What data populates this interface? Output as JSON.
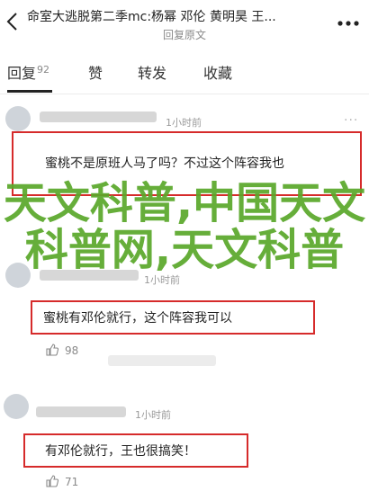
{
  "header": {
    "title": "命室大逃脱第二季mc:杨幂 邓伦 黄明昊 王...",
    "subtitle": "回复原文"
  },
  "tabs": [
    {
      "label": "回复",
      "count": "92"
    },
    {
      "label": "赞"
    },
    {
      "label": "转发"
    },
    {
      "label": "收藏"
    }
  ],
  "comments": [
    {
      "time": "1小时前",
      "text": "蜜桃不是原班人马了吗？不过这个阵容我也"
    },
    {
      "time": "1小时前",
      "text": "蜜桃有邓伦就行，这个阵容我可以",
      "likes": "98"
    },
    {
      "time": "1小时前",
      "text": "有邓伦就行，王也很搞笑！",
      "likes": "71"
    }
  ],
  "watermark": "天文科普,中国天文科普网,天文科普",
  "icons": [
    "back-icon",
    "more-icon",
    "thumb-up-icon"
  ]
}
